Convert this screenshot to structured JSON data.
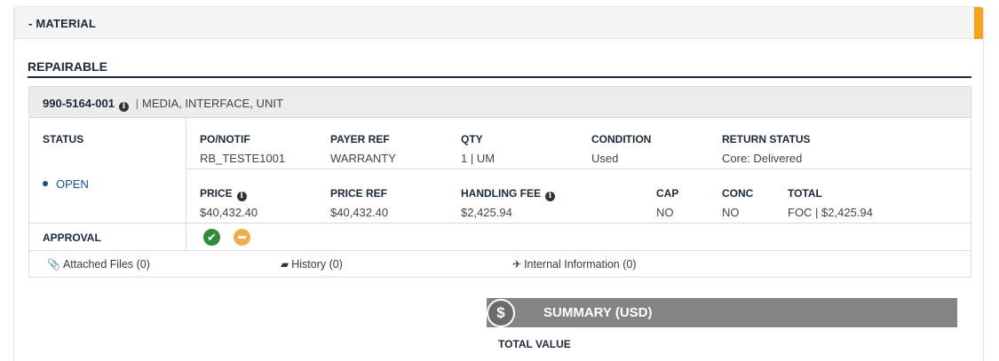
{
  "panel": {
    "title": "- MATERIAL",
    "accent_color": "#f7a21b"
  },
  "section": {
    "title": "REPAIRABLE"
  },
  "item": {
    "part_number": "990-5164-001",
    "info_icon": "info-circle-icon",
    "separator": "|",
    "description": "MEDIA, INTERFACE, UNIT",
    "status": {
      "label": "STATUS",
      "value": "OPEN"
    },
    "details_row1": [
      {
        "label": "PO/NOTIF",
        "value": "RB_TESTE1001"
      },
      {
        "label": "PAYER REF",
        "value": "WARRANTY"
      },
      {
        "label": "QTY",
        "value": "1 | UM"
      },
      {
        "label": "CONDITION",
        "value": "Used"
      },
      {
        "label": "RETURN STATUS",
        "value": "Core: Delivered"
      }
    ],
    "details_row2": [
      {
        "label": "PRICE",
        "value": "$40,432.40"
      },
      {
        "label": "PRICE REF",
        "value": "$40,432.40"
      },
      {
        "label": "HANDLING FEE",
        "value": "$2,425.94"
      },
      {
        "label": "CAP",
        "value": "NO"
      },
      {
        "label": "CONC",
        "value": "NO"
      },
      {
        "label": "TOTAL",
        "value": "FOC | $2,425.94"
      }
    ],
    "approval": {
      "label": "APPROVAL",
      "approved_icon": "check-circle-icon",
      "pending_icon": "minus-circle-icon"
    },
    "links": [
      {
        "label": "Attached Files (0)",
        "icon": "paperclip-icon"
      },
      {
        "label": "History (0)",
        "icon": "book-icon"
      },
      {
        "label": "Internal Information (0)",
        "icon": "plane-icon"
      }
    ]
  },
  "summary": {
    "title": "SUMMARY (USD)",
    "icon": "dollar-icon",
    "total_value_label": "TOTAL VALUE"
  },
  "colors": {
    "navy": "#1b2a3a",
    "status_blue": "#1a4f8a",
    "approved": "#2e8b3a",
    "pending": "#f0ad4e",
    "summary_bar": "#848484"
  }
}
